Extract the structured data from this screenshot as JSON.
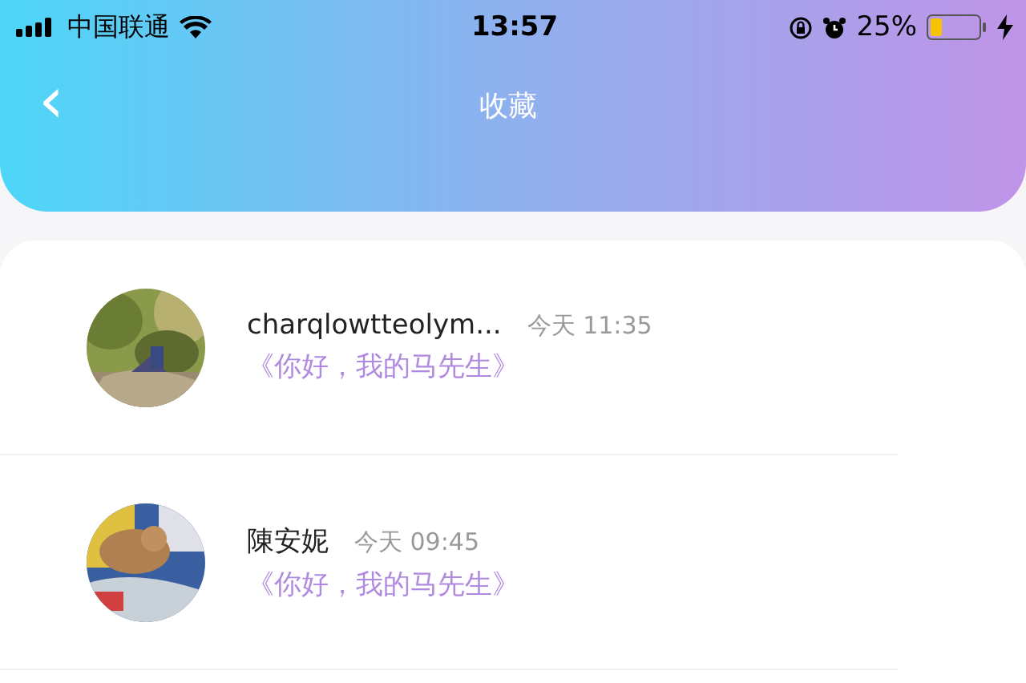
{
  "status_bar": {
    "carrier": "中国联通",
    "time": "13:57",
    "battery": "25%"
  },
  "header": {
    "title": "收藏",
    "back": "‹"
  },
  "items": [
    {
      "name": "charqlowtteolym...",
      "time": "今天 11:35",
      "title": "《你好，我的马先生》"
    },
    {
      "name": "陳安妮",
      "time": "今天 09:45",
      "title": "《你好，我的马先生》"
    }
  ]
}
